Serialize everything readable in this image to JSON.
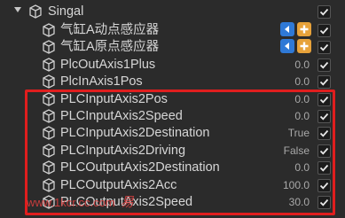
{
  "tree": {
    "root_label": "Singal",
    "items": [
      {
        "label": "气缸A动点感应器",
        "value": "",
        "buttons": true,
        "checked": true
      },
      {
        "label": "气缸A原点感应器",
        "value": "",
        "buttons": true,
        "checked": true
      },
      {
        "label": "PlcOutAxis1Plus",
        "value": "0.0",
        "buttons": false,
        "checked": true
      },
      {
        "label": "PlcInAxis1Pos",
        "value": "0.0",
        "buttons": false,
        "checked": true
      },
      {
        "label": "PLCInputAxis2Pos",
        "value": "0.0",
        "buttons": false,
        "checked": true
      },
      {
        "label": "PLCInputAxis2Speed",
        "value": "0.0",
        "buttons": false,
        "checked": true
      },
      {
        "label": "PLCInputAxis2Destination",
        "value": "True",
        "buttons": false,
        "checked": true
      },
      {
        "label": "PLCInputAxis2Driving",
        "value": "False",
        "buttons": false,
        "checked": true
      },
      {
        "label": "PLCOutputAxis2Destination",
        "value": "0.0",
        "buttons": false,
        "checked": true
      },
      {
        "label": "PLCOutputAxis2Acc",
        "value": "100.0",
        "buttons": false,
        "checked": true
      },
      {
        "label": "PLCOutputAxis2Speed",
        "value": "30.0",
        "buttons": false,
        "checked": true
      }
    ]
  },
  "watermark": {
    "text": "www.1kcr.cc.com",
    "brand": "易"
  },
  "colors": {
    "background": "#2b2b2b",
    "text": "#d6d6d6",
    "value": "#a9a9a9",
    "highlight": "#e01e1e",
    "button_blue": "#2f79d6",
    "button_orange": "#e7a23a"
  },
  "icons": {
    "node": "cube-icon",
    "foldout": "triangle-down-icon",
    "check": "checkmark-icon",
    "left": "arrow-left-icon",
    "plus": "plus-icon"
  }
}
